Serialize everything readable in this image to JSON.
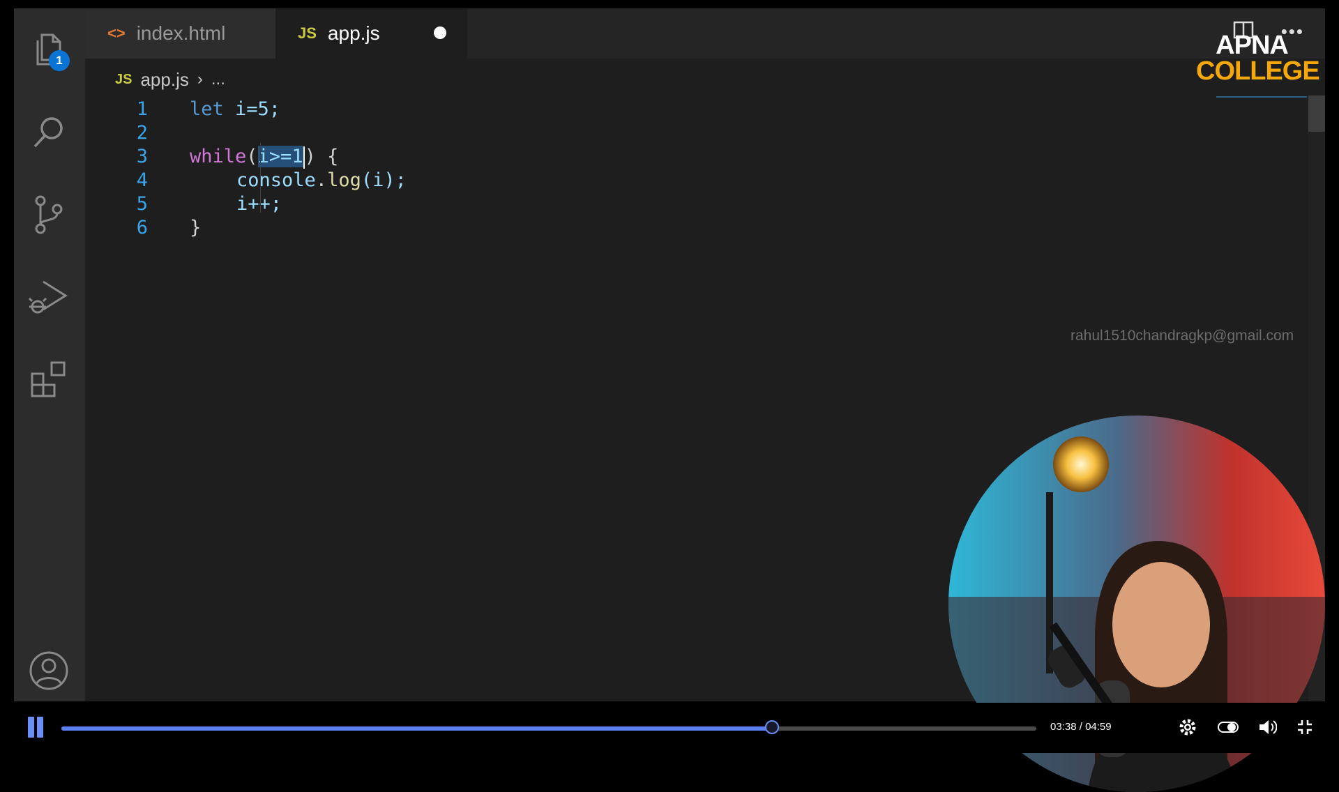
{
  "activity_bar": {
    "explorer_badge": "1",
    "icons": [
      "files-icon",
      "search-icon",
      "source-control-icon",
      "run-debug-icon",
      "extensions-icon",
      "account-icon"
    ]
  },
  "tabs": [
    {
      "icon": "<>",
      "label": "index.html",
      "active": false
    },
    {
      "icon": "JS",
      "label": "app.js",
      "active": true,
      "unsaved": true
    }
  ],
  "logo": {
    "line1": "APNA",
    "line2": "COLLEGE"
  },
  "breadcrumb": {
    "icon": "JS",
    "file": "app.js",
    "ellipsis": "..."
  },
  "editor": {
    "lines": [
      {
        "n": "1",
        "parts": {
          "kw": "let",
          "rest": " i=5;"
        }
      },
      {
        "n": "2"
      },
      {
        "n": "3",
        "parts": {
          "kw": "while",
          "open": "(",
          "selected": "i>=1",
          "close": ") {"
        }
      },
      {
        "n": "4",
        "parts": {
          "obj": "console",
          "dot": ".",
          "fn": "log",
          "args": "(i);"
        }
      },
      {
        "n": "5",
        "parts": {
          "text": "i++;"
        }
      },
      {
        "n": "6",
        "parts": {
          "text": "}"
        }
      }
    ]
  },
  "watermark_email": "rahul1510chandragkp@gmail.com",
  "player": {
    "current_time": "03:38",
    "separator": " / ",
    "duration": "04:59",
    "progress_fraction": 0.729
  },
  "colors": {
    "accent": "#6b8ff6",
    "badge": "#0a74d4",
    "logo_orange": "#f6a70a",
    "js_yellow": "#cbcb41"
  }
}
